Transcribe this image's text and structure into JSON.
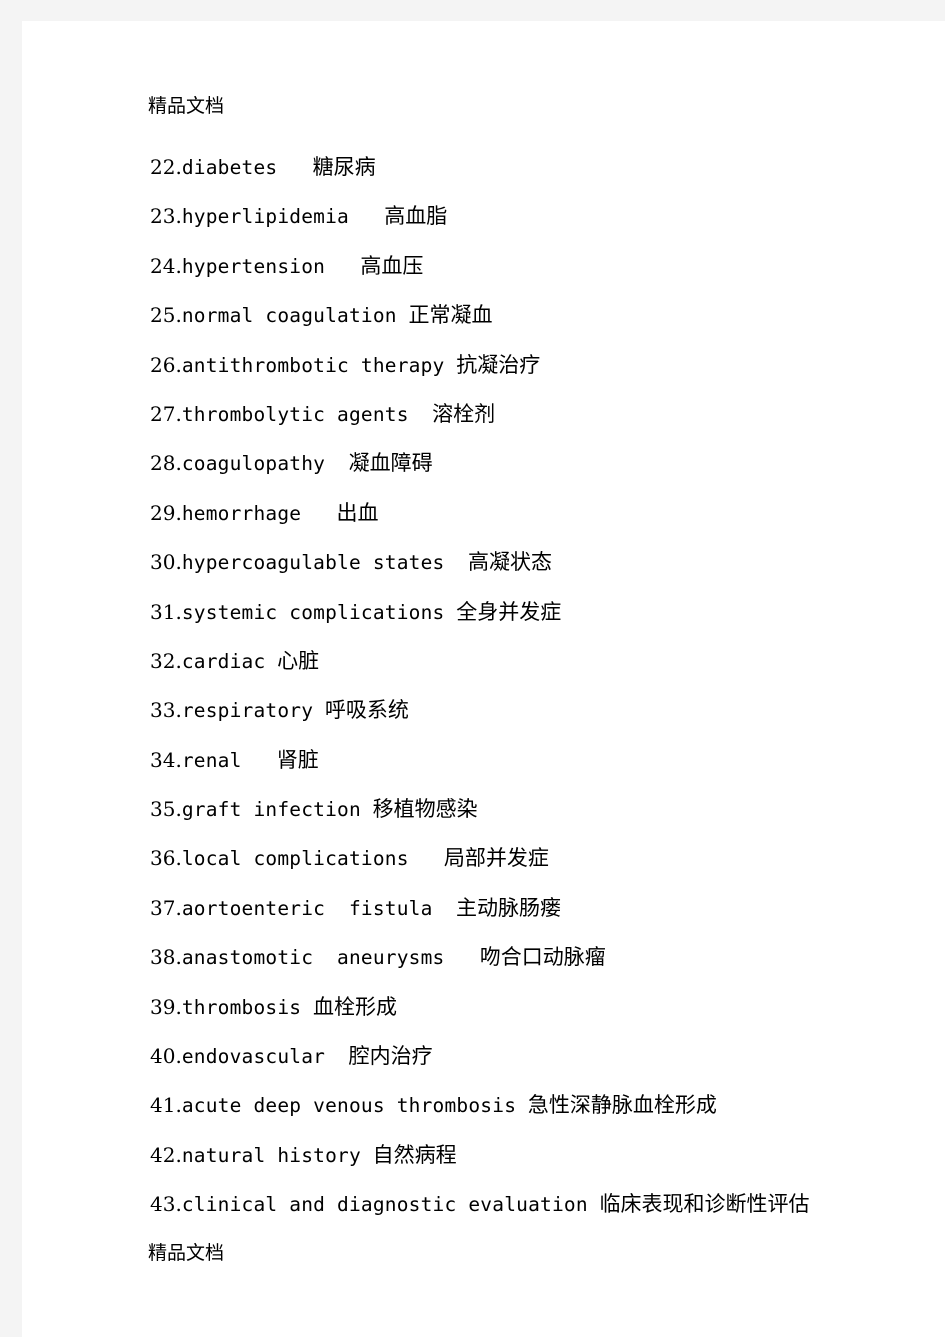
{
  "page": {
    "header_stamp": "精品文档",
    "footer_stamp": "精品文档",
    "background_color": "#f4f4f4",
    "sheet_color": "#ffffff",
    "text_color": "#000000"
  },
  "glossary": {
    "entries": [
      {
        "index": "22.",
        "term": "diabetes",
        "gap": "   ",
        "gloss": "糖尿病"
      },
      {
        "index": "23.",
        "term": "hyperlipidemia",
        "gap": "   ",
        "gloss": "高血脂"
      },
      {
        "index": "24.",
        "term": "hypertension",
        "gap": "   ",
        "gloss": "高血压"
      },
      {
        "index": "25.",
        "term": "normal coagulation",
        "gap": " ",
        "gloss": "正常凝血"
      },
      {
        "index": "26.",
        "term": "antithrombotic therapy",
        "gap": " ",
        "gloss": "抗凝治疗"
      },
      {
        "index": "27.",
        "term": "thrombolytic agents",
        "gap": "  ",
        "gloss": "溶栓剂"
      },
      {
        "index": "28.",
        "term": "coagulopathy",
        "gap": "  ",
        "gloss": "凝血障碍"
      },
      {
        "index": "29.",
        "term": "hemorrhage",
        "gap": "   ",
        "gloss": "出血"
      },
      {
        "index": "30.",
        "term": "hypercoagulable states",
        "gap": "  ",
        "gloss": "高凝状态"
      },
      {
        "index": "31.",
        "term": "systemic complications",
        "gap": " ",
        "gloss": "全身并发症"
      },
      {
        "index": "32.",
        "term": "cardiac",
        "gap": " ",
        "gloss": "心脏"
      },
      {
        "index": "33.",
        "term": "respiratory",
        "gap": " ",
        "gloss": "呼吸系统"
      },
      {
        "index": "34.",
        "term": "renal",
        "gap": "   ",
        "gloss": "肾脏"
      },
      {
        "index": "35.",
        "term": "graft infection",
        "gap": " ",
        "gloss": "移植物感染"
      },
      {
        "index": "36.",
        "term": "local complications",
        "gap": "   ",
        "gloss": "局部并发症"
      },
      {
        "index": "37.",
        "term": "aortoenteric  fistula",
        "gap": "  ",
        "gloss": "主动脉肠瘘"
      },
      {
        "index": "38.",
        "term": "anastomotic  aneurysms",
        "gap": "   ",
        "gloss": "吻合口动脉瘤"
      },
      {
        "index": "39.",
        "term": "thrombosis",
        "gap": " ",
        "gloss": "血栓形成"
      },
      {
        "index": "40.",
        "term": "endovascular",
        "gap": "  ",
        "gloss": "腔内治疗"
      },
      {
        "index": "41.",
        "term": "acute deep venous thrombosis",
        "gap": " ",
        "gloss": "急性深静脉血栓形成"
      },
      {
        "index": "42.",
        "term": "natural history",
        "gap": " ",
        "gloss": "自然病程"
      },
      {
        "index": "43.",
        "term": "clinical and diagnostic evaluation",
        "gap": " ",
        "gloss": "临床表现和诊断性评估"
      }
    ]
  }
}
